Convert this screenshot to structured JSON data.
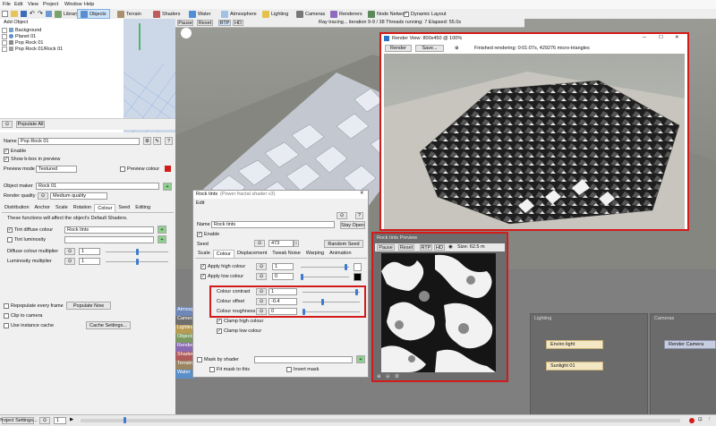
{
  "menu": [
    "File",
    "Edit",
    "View",
    "Project",
    "Window",
    "Help"
  ],
  "toolbar": {
    "tabs": [
      "Library",
      "Objects",
      "Terrain",
      "Shaders",
      "Water",
      "Atmosphere",
      "Lighting",
      "Cameras",
      "Renderers",
      "Node Network"
    ],
    "dynamic_layout": "Dynamic Layout"
  },
  "status": {
    "pause": "Pause",
    "reset": "Reset",
    "rtp": "RTP",
    "hd": "HD",
    "message": "Ray tracing... iteration 9-9 / 38    Threads running: 7    Elapsed: 55.0s"
  },
  "objects_panel": {
    "add_object": "Add Object",
    "tree": [
      "Background",
      "Planet 01",
      "Pop Rock 01",
      "Pop Rock 01/Rock 01"
    ],
    "populate_all": "Populate All"
  },
  "props": {
    "name_label": "Name",
    "name_value": "Pop Rock 01",
    "enable": "Enable",
    "show_bbox": "Show b-box in preview",
    "preview_mode_label": "Preview mode",
    "preview_mode_value": "Textured",
    "preview_colour": "Preview colour",
    "object_maker_label": "Object maker",
    "object_maker_value": "Rock 01",
    "render_quality_label": "Render quality",
    "render_quality_value": "Medium quality",
    "tabs": [
      "Distribution",
      "Anchor",
      "Scale",
      "Rotation",
      "Colour",
      "Seed",
      "Editing"
    ],
    "desc": "These functions will affect the object's Default Shaders.",
    "tint_diffuse": "Tint diffuse colour",
    "tint_diffuse_value": "Rock tints",
    "tint_lum": "Tint luminosity",
    "diff_mult_label": "Diffuse colour multiplier",
    "diff_mult_value": "1",
    "lum_mult_label": "Luminosity multiplier",
    "lum_mult_value": "1",
    "repopulate": "Repopulate every frame",
    "populate_now": "Populate Now",
    "clip": "Clip to camera",
    "instance_cache": "Use instance cache",
    "cache_settings": "Cache Settings..."
  },
  "side_list": [
    "Atmosph",
    "Camera",
    "Lighting",
    "Objects",
    "Render",
    "Shaders",
    "Terrain",
    "Water"
  ],
  "rock_tints": {
    "title": "Rock tints",
    "subtitle": "(Power fractal shader v3)",
    "edit": "Edit",
    "name_label": "Name",
    "name_value": "Rock tints",
    "stay_open": "Stay Open",
    "enable": "Enable",
    "seed_label": "Seed",
    "seed_value": "473",
    "random_seed": "Random Seed",
    "tabs": [
      "Scale",
      "Colour",
      "Displacement",
      "Tweak Noise",
      "Warping",
      "Animation"
    ],
    "apply_high": "Apply high colour",
    "apply_high_value": "1",
    "apply_low": "Apply low colour",
    "apply_low_value": "0",
    "contrast_label": "Colour contrast",
    "contrast_value": "1",
    "offset_label": "Colour offset",
    "offset_value": "-0.4",
    "roughness_label": "Colour roughness",
    "roughness_value": "0",
    "clamp_high": "Clamp high colour",
    "clamp_low": "Clamp low colour",
    "mask_label": "Mask by shader",
    "fit_mask": "Fit mask to this",
    "invert_mask": "Invert mask"
  },
  "render_view": {
    "title": "Render View: 800x450 @ 100%",
    "render": "Render",
    "save": "Save...",
    "status": "Finished rendering: 0:01:07s, 429276 micro-triangles"
  },
  "preview": {
    "title": "Rock tints Preview",
    "pause": "Pause",
    "reset": "Reset",
    "rtp": "RTP",
    "hd": "HD",
    "size": "Size: 62.5 m"
  },
  "nodes": {
    "lighting_header": "Lighting",
    "cameras_header": "Cameras",
    "enviro_light": "Enviro light",
    "sunlight": "Sunlight 01",
    "render_camera": "Render Camera"
  },
  "bottom": {
    "project_settings": "Project Settings...",
    "frame": "1"
  },
  "colors": {
    "accent_red": "#d21b1b",
    "selection_blue": "#cde3f7",
    "node_fill": "#f4e7c3"
  }
}
